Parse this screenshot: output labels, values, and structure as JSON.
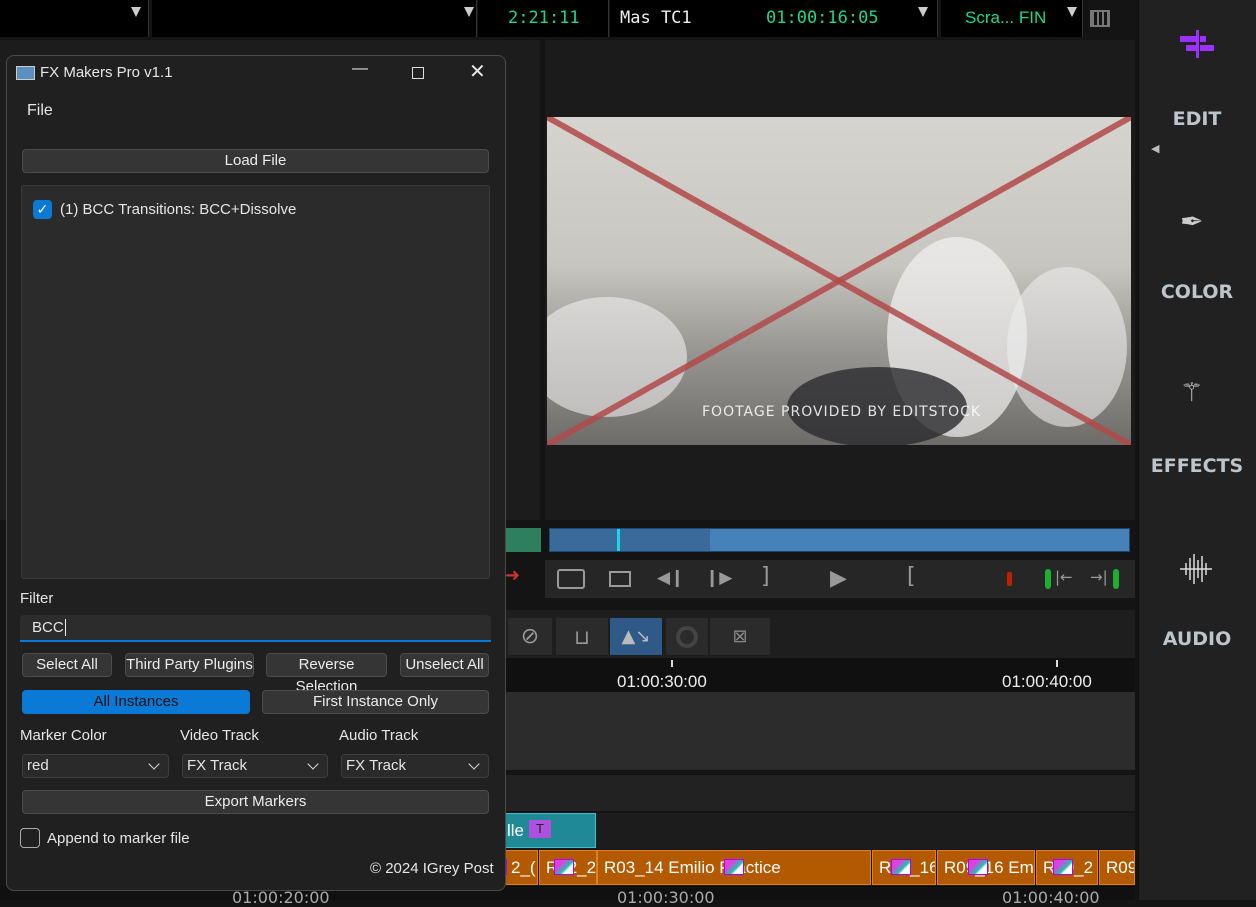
{
  "topbar": {
    "timecode_left": "2:21:11",
    "master_label": "Mas TC1",
    "master_timecode": "01:00:16:05",
    "bin_label": "Scra... FIN"
  },
  "sidebar": {
    "items": [
      {
        "label": "EDIT",
        "icon": "timeline-edit-icon",
        "color": "#9b30ff"
      },
      {
        "label": "COLOR",
        "icon": "eyedropper-icon"
      },
      {
        "label": "EFFECTS",
        "icon": "magic-wand-icon"
      },
      {
        "label": "AUDIO",
        "icon": "waveform-icon"
      }
    ]
  },
  "monitor": {
    "watermark": "FOOTAGE PROVIDED BY EDITSTOCK"
  },
  "timeline": {
    "ruler_labels": [
      "01:00:30:00",
      "01:00:40:00"
    ],
    "bottom_ruler_labels": [
      "01:00:20:00",
      "01:00:30:00",
      "01:00:40:00"
    ],
    "title_clip": "lle",
    "clips": [
      "2_(",
      "R02_2",
      "R03_14 Emilio Practice",
      "R03_16",
      "R09_16 Em",
      "R09_2",
      "R09"
    ]
  },
  "dialog": {
    "title": "FX Makers Pro v1.1",
    "menu": [
      "File"
    ],
    "load_button": "Load File",
    "list_items": [
      {
        "label": "(1) BCC Transitions:  BCC+Dissolve",
        "checked": true
      }
    ],
    "filter_label": "Filter",
    "filter_value": "BCC",
    "buttons": [
      "Select All",
      "Third Party Plugins",
      "Reverse Selection",
      "Unselect All"
    ],
    "instance_modes": [
      {
        "label": "All Instances",
        "selected": true
      },
      {
        "label": "First Instance Only",
        "selected": false
      }
    ],
    "marker_color_label": "Marker Color",
    "marker_color_value": "red",
    "video_track_label": "Video Track",
    "video_track_value": "FX Track",
    "audio_track_label": "Audio Track",
    "audio_track_value": "FX Track",
    "export_button": "Export Markers",
    "append_label": "Append to marker file",
    "append_checked": false,
    "copyright": "© 2024 IGrey Post",
    "accent": "#0a7ad6"
  }
}
